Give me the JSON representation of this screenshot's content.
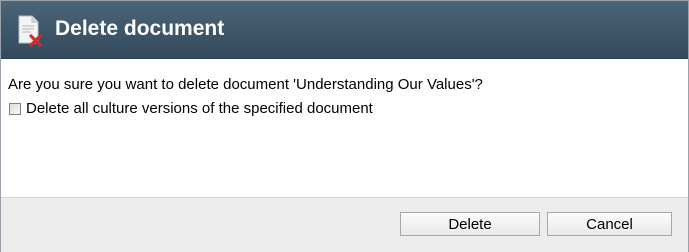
{
  "dialog": {
    "title": "Delete document",
    "title_icon": "document-delete-icon",
    "question": "Are you sure you want to delete document 'Understanding Our Values'?",
    "checkbox": {
      "label": "Delete all culture versions of the specified document",
      "checked": false
    },
    "buttons": {
      "delete_label": "Delete",
      "cancel_label": "Cancel"
    }
  },
  "colors": {
    "title_bar": "#3d5568",
    "title_text": "#ffffff",
    "footer": "#ececec",
    "delete_mark": "#d62a2a"
  }
}
